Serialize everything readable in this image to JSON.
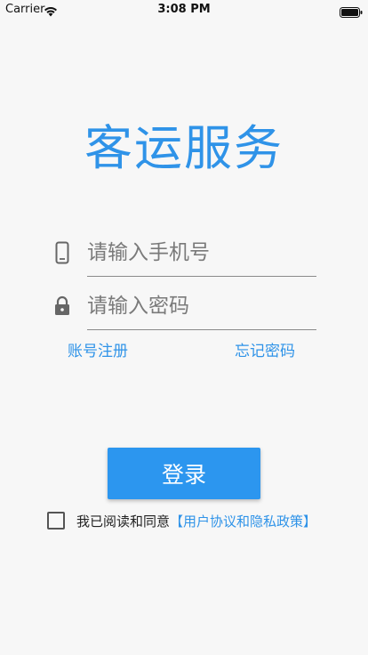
{
  "status_bar": {
    "carrier": "Carrier",
    "time": "3:08 PM",
    "wifi_icon": "wifi-icon",
    "battery_icon": "battery-icon"
  },
  "title": "客运服务",
  "phone_field": {
    "placeholder": "请输入手机号",
    "value": "",
    "icon": "mobile-phone-icon"
  },
  "password_field": {
    "placeholder": "请输入密码",
    "value": "",
    "icon": "lock-icon"
  },
  "links": {
    "register": "账号注册",
    "forgot_password": "忘记密码"
  },
  "login_button": "登录",
  "agreement": {
    "checked": false,
    "text": "我已阅读和同意",
    "link_text": "【用户协议和隐私政策】"
  },
  "colors": {
    "accent": "#2f93e8",
    "button": "#2c96ef",
    "background": "#f7f7f7"
  }
}
